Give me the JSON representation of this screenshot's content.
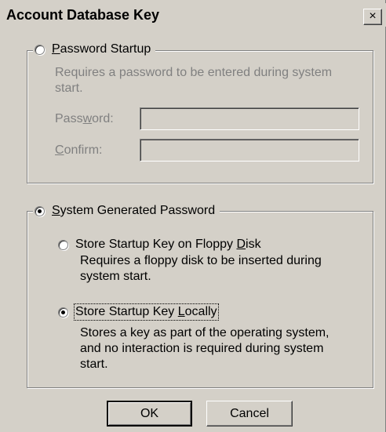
{
  "window": {
    "title": "Account Database Key",
    "close_glyph": "×"
  },
  "password_startup": {
    "label": "Password Startup",
    "label_u": "P",
    "label_rest": "assword Startup",
    "selected": false,
    "description": "Requires a password to be entered during system start.",
    "password_label_pre": "Pass",
    "password_label_u": "w",
    "password_label_post": "ord:",
    "password_value": "",
    "confirm_label_u": "C",
    "confirm_label_post": "onfirm:",
    "confirm_value": ""
  },
  "system_generated": {
    "label_u": "S",
    "label_rest": "ystem Generated Password",
    "selected": true,
    "floppy": {
      "label_pre": "Store Startup Key on Floppy ",
      "label_u": "D",
      "label_post": "isk",
      "selected": false,
      "description": "Requires a floppy disk to be inserted during system start."
    },
    "locally": {
      "label_pre": "Store Startup Key ",
      "label_u": "L",
      "label_post": "ocally",
      "selected": true,
      "description": "Stores a key as part of the operating system, and no interaction is required during system start."
    }
  },
  "buttons": {
    "ok_label": "OK",
    "cancel_label": "Cancel"
  }
}
